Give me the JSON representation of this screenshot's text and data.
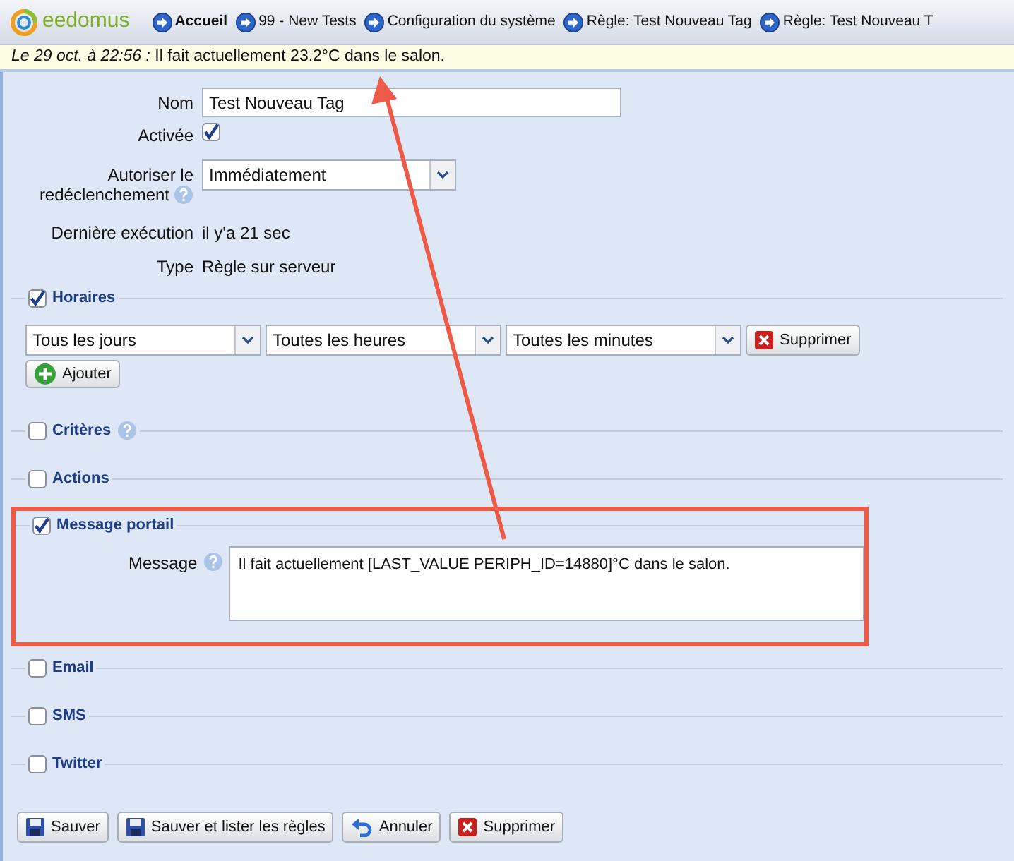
{
  "header": {
    "logo": "eedomus",
    "breadcrumbs": [
      {
        "label": "Accueil",
        "selected": true
      },
      {
        "label": "99 - New Tests",
        "selected": false
      },
      {
        "label": "Configuration du système",
        "selected": false
      },
      {
        "label": "Règle: Test Nouveau Tag",
        "selected": false
      },
      {
        "label": "Règle: Test Nouveau T",
        "selected": false
      }
    ]
  },
  "notice": {
    "date": "Le 29 oct. à 22:56 :",
    "text": "Il fait actuellement 23.2°C dans le salon."
  },
  "form": {
    "name": {
      "label": "Nom",
      "value": "Test Nouveau Tag"
    },
    "enabled": {
      "label": "Activée",
      "checked": true
    },
    "retrigger": {
      "label_line_1": "Autoriser le",
      "label_line_2": "redéclenchement",
      "value": "Immédiatement"
    },
    "last_run": {
      "label": "Dernière exécution",
      "value": "il y'a 21 sec"
    },
    "type": {
      "label": "Type",
      "value": "Règle sur serveur"
    }
  },
  "sections": [
    {
      "kind": "schedule",
      "title": "Horaires",
      "checked": true,
      "help": false,
      "highlighted": false,
      "selects": [
        "Tous les jours",
        "Toutes les heures",
        "Toutes les minutes"
      ],
      "remove_button": "Supprimer",
      "add_button": "Ajouter"
    },
    {
      "kind": "plain",
      "title": "Critères",
      "checked": false,
      "help": true,
      "highlighted": false
    },
    {
      "kind": "plain",
      "title": "Actions",
      "checked": false,
      "help": false,
      "highlighted": false
    },
    {
      "kind": "message",
      "title": "Message portail",
      "checked": true,
      "help": false,
      "highlighted": true,
      "field_label": "Message",
      "field_value": "Il fait actuellement [LAST_VALUE PERIPH_ID=14880]°C dans le salon."
    },
    {
      "kind": "plain",
      "title": "Email",
      "checked": false,
      "help": false,
      "highlighted": false
    },
    {
      "kind": "plain",
      "title": "SMS",
      "checked": false,
      "help": false,
      "highlighted": false
    },
    {
      "kind": "plain",
      "title": "Twitter",
      "checked": false,
      "help": false,
      "highlighted": false
    }
  ],
  "buttons": [
    {
      "label": "Sauver",
      "kind": "save"
    },
    {
      "label": "Sauver et lister les règles",
      "kind": "save"
    },
    {
      "label": "Annuler",
      "kind": "undo"
    },
    {
      "label": "Supprimer",
      "kind": "delete"
    }
  ]
}
